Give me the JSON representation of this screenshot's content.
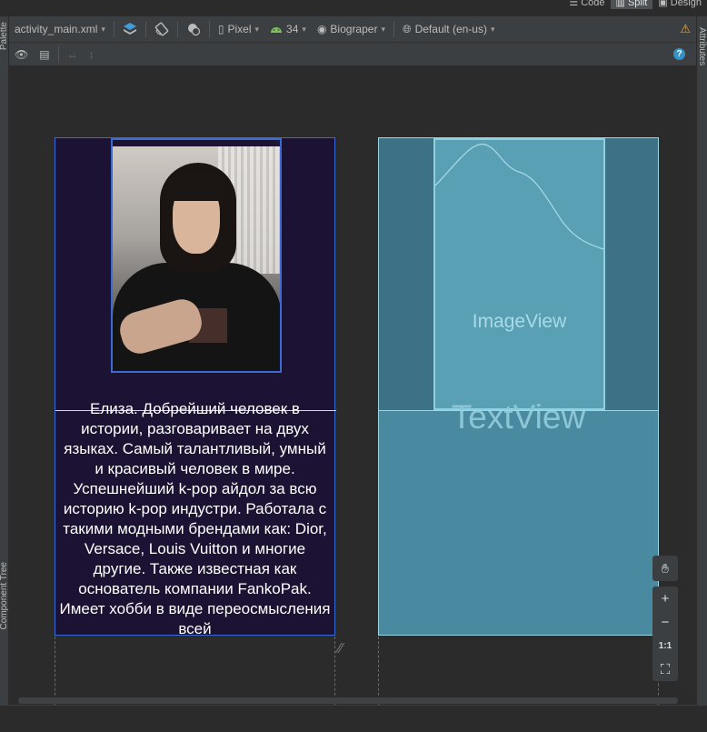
{
  "view_modes": {
    "code_label": "Code",
    "split_label": "Split",
    "design_label": "Design"
  },
  "side_panels": {
    "palette_label": "Palette",
    "component_tree_label": "Component Tree",
    "attributes_label": "Attributes"
  },
  "toolbar": {
    "file_tab": "activity_main.xml",
    "device": "Pixel",
    "api_level": "34",
    "theme": "Biograper",
    "locale": "Default (en-us)"
  },
  "design_preview": {
    "description_text": "Елиза. Добрейший человек в истории, разговаривает на двух языках. Самый талантливый, умный и красивый человек в мире. Успешнейший k-pop айдол за всю историю k-pop индустри. Работала с такими модными брендами как: Dior, Versace, Louis Vuitton и многие другие. Также известная как основатель компании FankoPak. Имеет хобби в виде переосмысления всей"
  },
  "blueprint_preview": {
    "image_label": "ImageView",
    "text_label": "TextView"
  },
  "zoom_controls": {
    "actual_size_label": "1:1"
  },
  "colors": {
    "accent_selection": "#3a6ad4",
    "blueprint_fill": "#4a8aa0",
    "warning": "#f0a732"
  }
}
